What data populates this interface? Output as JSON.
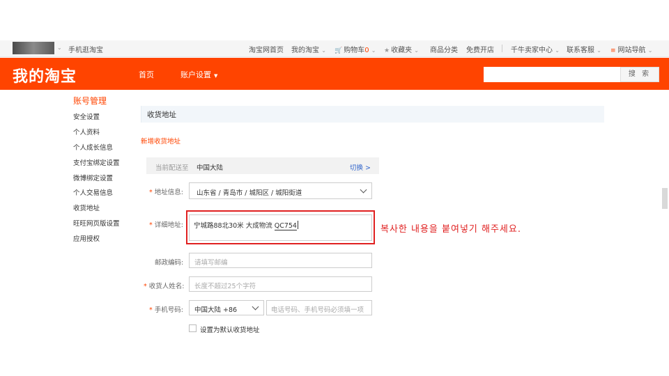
{
  "topbar": {
    "mobile": "手机逛淘宝",
    "home": "淘宝网首页",
    "my_taobao": "我的淘宝",
    "cart_label": "购物车",
    "cart_count": "0",
    "favorites": "收藏夹",
    "categories": "商品分类",
    "open_shop": "免费开店",
    "seller_center": "千牛卖家中心",
    "service": "联系客服",
    "site_nav": "网站导航"
  },
  "header": {
    "logo": "我的淘宝",
    "nav_home": "首页",
    "nav_account": "账户设置",
    "search_button": "搜 索"
  },
  "sidebar": {
    "title": "账号管理",
    "items": [
      "安全设置",
      "个人资料",
      "个人成长信息",
      "支付宝绑定设置",
      "微博绑定设置",
      "个人交易信息",
      "收货地址",
      "旺旺网页版设置",
      "应用授权"
    ]
  },
  "main": {
    "section_title": "收货地址",
    "new_address": "新增收货地址",
    "region": {
      "label": "当前配送至",
      "value": "中国大陆",
      "switch": "切换 >"
    },
    "form": {
      "address_label": "地址信息:",
      "address_value": "山东省 / 青岛市 / 城阳区 / 城阳街道",
      "detail_label": "详细地址:",
      "detail_value": "宁城路88北30米  大成物流 ",
      "detail_code": "QC754",
      "postal_label": "邮政编码:",
      "postal_placeholder": "请填写邮编",
      "name_label": "收货人姓名:",
      "name_placeholder": "长度不超过25个字符",
      "phone_label": "手机号码:",
      "phone_country": "中国大陆 +86",
      "phone_placeholder": "电话号码、手机号码必须填一项",
      "default_label": "设置为默认收货地址"
    },
    "callout": "복사한 내용을 붙여넣기 해주세요."
  },
  "colors": {
    "brand": "#ff4400",
    "highlight": "#e02020",
    "link": "#3366cc"
  }
}
